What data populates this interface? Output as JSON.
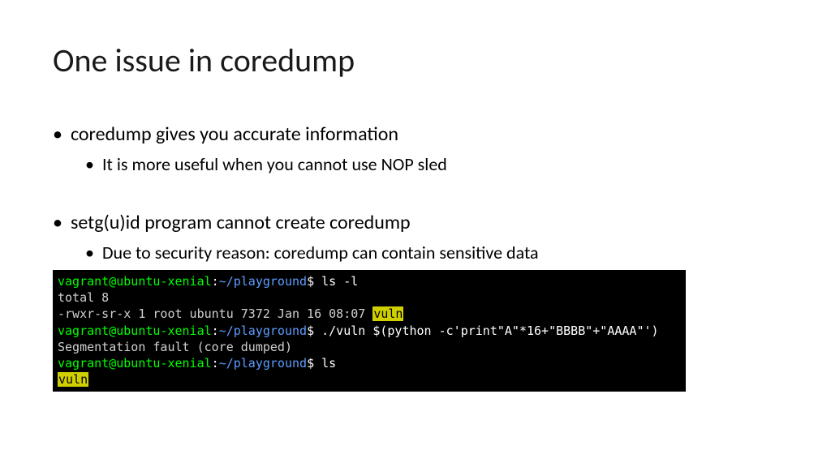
{
  "title": "One issue in coredump",
  "bullets": [
    {
      "text": "coredump gives you accurate information",
      "subs": [
        "It is more useful when you cannot use NOP sled"
      ]
    },
    {
      "text": "setg(u)id program cannot create coredump",
      "subs": [
        "Due to security reason: coredump can contain sensitive data"
      ]
    }
  ],
  "terminal": {
    "prompt_user": "vagrant@ubuntu-xenial",
    "prompt_sep": ":",
    "prompt_path": "~/playground",
    "prompt_dollar": "$",
    "lines": {
      "cmd1": "ls -l",
      "out1": "total 8",
      "out2_perms": "-rwxr-sr-x 1 root ubuntu 7372 Jan 16 08:07 ",
      "out2_file": "vuln",
      "cmd2": "./vuln $(python -c'print\"A\"*16+\"BBBB\"+\"AAAA\"')",
      "out3": "Segmentation fault (core dumped)",
      "cmd3": "ls",
      "out4_file": "vuln"
    }
  }
}
